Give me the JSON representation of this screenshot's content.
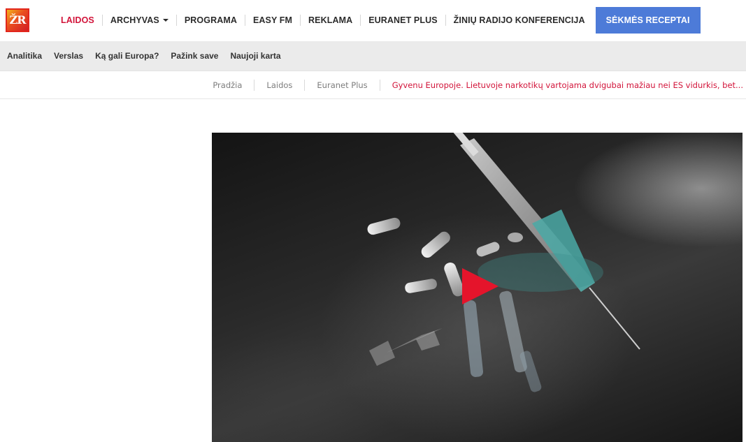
{
  "header": {
    "logo_text": "ŽR",
    "nav": [
      {
        "label": "LAIDOS",
        "active": true
      },
      {
        "label": "ARCHYVAS",
        "dropdown": true
      },
      {
        "label": "PROGRAMA"
      },
      {
        "label": "EASY FM"
      },
      {
        "label": "REKLAMA"
      },
      {
        "label": "EURANET PLUS"
      },
      {
        "label": "ŽINIŲ RADIJO KONFERENCIJA"
      }
    ],
    "cta_label": "SĖKMĖS RECEPTAI"
  },
  "subnav": {
    "items": [
      "Analitika",
      "Verslas",
      "Ką gali Europa?",
      "Pažink save",
      "Naujoji karta"
    ]
  },
  "breadcrumb": {
    "items": [
      "Pradžia",
      "Laidos",
      "Euranet Plus"
    ],
    "current": "Gyvenu Europoje. Lietuvoje narkotikų vartojama dvigubai mažiau nei ES vidurkis, bet..."
  },
  "colors": {
    "active_nav": "#d2143a",
    "cta_bg": "#4d7bd8",
    "play_button": "#e5142b",
    "subnav_bg": "#ebebeb"
  },
  "icons": {
    "play": "play-icon",
    "dropdown": "caret-down-icon"
  }
}
